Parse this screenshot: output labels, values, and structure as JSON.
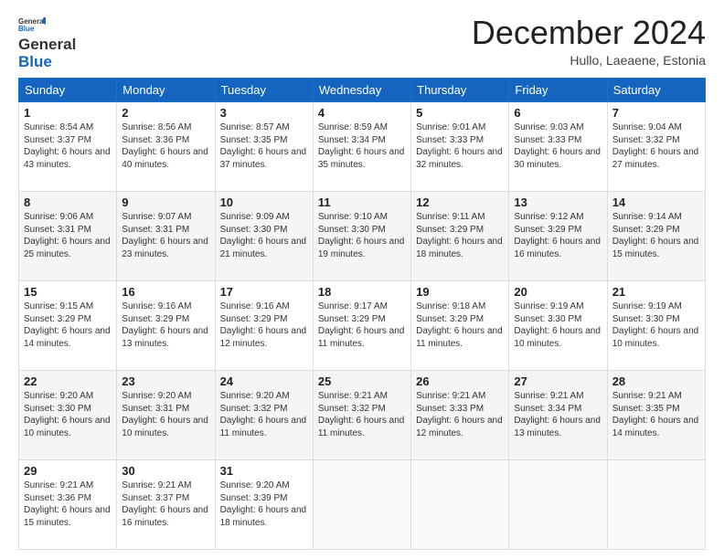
{
  "logo": {
    "line1": "General",
    "line2": "Blue"
  },
  "title": "December 2024",
  "location": "Hullo, Laeaene, Estonia",
  "days_of_week": [
    "Sunday",
    "Monday",
    "Tuesday",
    "Wednesday",
    "Thursday",
    "Friday",
    "Saturday"
  ],
  "weeks": [
    [
      {
        "day": "1",
        "sunrise": "8:54 AM",
        "sunset": "3:37 PM",
        "daylight": "6 hours and 43 minutes."
      },
      {
        "day": "2",
        "sunrise": "8:56 AM",
        "sunset": "3:36 PM",
        "daylight": "6 hours and 40 minutes."
      },
      {
        "day": "3",
        "sunrise": "8:57 AM",
        "sunset": "3:35 PM",
        "daylight": "6 hours and 37 minutes."
      },
      {
        "day": "4",
        "sunrise": "8:59 AM",
        "sunset": "3:34 PM",
        "daylight": "6 hours and 35 minutes."
      },
      {
        "day": "5",
        "sunrise": "9:01 AM",
        "sunset": "3:33 PM",
        "daylight": "6 hours and 32 minutes."
      },
      {
        "day": "6",
        "sunrise": "9:03 AM",
        "sunset": "3:33 PM",
        "daylight": "6 hours and 30 minutes."
      },
      {
        "day": "7",
        "sunrise": "9:04 AM",
        "sunset": "3:32 PM",
        "daylight": "6 hours and 27 minutes."
      }
    ],
    [
      {
        "day": "8",
        "sunrise": "9:06 AM",
        "sunset": "3:31 PM",
        "daylight": "6 hours and 25 minutes."
      },
      {
        "day": "9",
        "sunrise": "9:07 AM",
        "sunset": "3:31 PM",
        "daylight": "6 hours and 23 minutes."
      },
      {
        "day": "10",
        "sunrise": "9:09 AM",
        "sunset": "3:30 PM",
        "daylight": "6 hours and 21 minutes."
      },
      {
        "day": "11",
        "sunrise": "9:10 AM",
        "sunset": "3:30 PM",
        "daylight": "6 hours and 19 minutes."
      },
      {
        "day": "12",
        "sunrise": "9:11 AM",
        "sunset": "3:29 PM",
        "daylight": "6 hours and 18 minutes."
      },
      {
        "day": "13",
        "sunrise": "9:12 AM",
        "sunset": "3:29 PM",
        "daylight": "6 hours and 16 minutes."
      },
      {
        "day": "14",
        "sunrise": "9:14 AM",
        "sunset": "3:29 PM",
        "daylight": "6 hours and 15 minutes."
      }
    ],
    [
      {
        "day": "15",
        "sunrise": "9:15 AM",
        "sunset": "3:29 PM",
        "daylight": "6 hours and 14 minutes."
      },
      {
        "day": "16",
        "sunrise": "9:16 AM",
        "sunset": "3:29 PM",
        "daylight": "6 hours and 13 minutes."
      },
      {
        "day": "17",
        "sunrise": "9:16 AM",
        "sunset": "3:29 PM",
        "daylight": "6 hours and 12 minutes."
      },
      {
        "day": "18",
        "sunrise": "9:17 AM",
        "sunset": "3:29 PM",
        "daylight": "6 hours and 11 minutes."
      },
      {
        "day": "19",
        "sunrise": "9:18 AM",
        "sunset": "3:29 PM",
        "daylight": "6 hours and 11 minutes."
      },
      {
        "day": "20",
        "sunrise": "9:19 AM",
        "sunset": "3:30 PM",
        "daylight": "6 hours and 10 minutes."
      },
      {
        "day": "21",
        "sunrise": "9:19 AM",
        "sunset": "3:30 PM",
        "daylight": "6 hours and 10 minutes."
      }
    ],
    [
      {
        "day": "22",
        "sunrise": "9:20 AM",
        "sunset": "3:30 PM",
        "daylight": "6 hours and 10 minutes."
      },
      {
        "day": "23",
        "sunrise": "9:20 AM",
        "sunset": "3:31 PM",
        "daylight": "6 hours and 10 minutes."
      },
      {
        "day": "24",
        "sunrise": "9:20 AM",
        "sunset": "3:32 PM",
        "daylight": "6 hours and 11 minutes."
      },
      {
        "day": "25",
        "sunrise": "9:21 AM",
        "sunset": "3:32 PM",
        "daylight": "6 hours and 11 minutes."
      },
      {
        "day": "26",
        "sunrise": "9:21 AM",
        "sunset": "3:33 PM",
        "daylight": "6 hours and 12 minutes."
      },
      {
        "day": "27",
        "sunrise": "9:21 AM",
        "sunset": "3:34 PM",
        "daylight": "6 hours and 13 minutes."
      },
      {
        "day": "28",
        "sunrise": "9:21 AM",
        "sunset": "3:35 PM",
        "daylight": "6 hours and 14 minutes."
      }
    ],
    [
      {
        "day": "29",
        "sunrise": "9:21 AM",
        "sunset": "3:36 PM",
        "daylight": "6 hours and 15 minutes."
      },
      {
        "day": "30",
        "sunrise": "9:21 AM",
        "sunset": "3:37 PM",
        "daylight": "6 hours and 16 minutes."
      },
      {
        "day": "31",
        "sunrise": "9:20 AM",
        "sunset": "3:39 PM",
        "daylight": "6 hours and 18 minutes."
      },
      null,
      null,
      null,
      null
    ]
  ],
  "labels": {
    "sunrise": "Sunrise: ",
    "sunset": "Sunset: ",
    "daylight": "Daylight: "
  }
}
